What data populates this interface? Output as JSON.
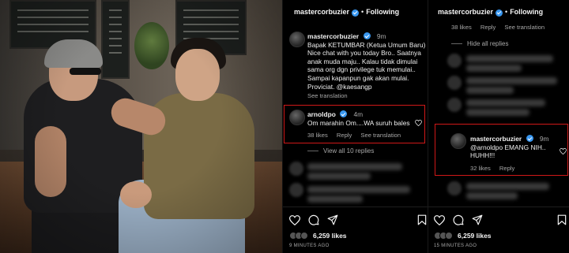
{
  "left_panel": {
    "header": {
      "username": "mastercorbuzier",
      "separator": "•",
      "follow_label": "Following"
    },
    "caption": {
      "username": "mastercorbuzier",
      "time": "9m",
      "lines": [
        "Bapak KETUMBAR (Ketua Umum Baru)",
        "Nice chat with you today Bro.. Saatnya",
        "anak muda maju.. Kalau tidak dimulai",
        "sama org dgn privilege tuk memulai..",
        "Sampai kapanpun gak akan mulai.",
        "Proviciat. @kaesangp"
      ],
      "see_translation": "See translation"
    },
    "highlighted_comment": {
      "username": "arnoldpo",
      "time": "4m",
      "text": "Om marahin Om....WA suruh bales",
      "likes": "38 likes",
      "reply": "Reply",
      "see_translation": "See translation"
    },
    "view_replies": "View all 10 replies",
    "likes_count": "6,259 likes",
    "time_ago": "9 MINUTES AGO"
  },
  "right_panel": {
    "header": {
      "username": "mastercorbuzier",
      "separator": "•",
      "follow_label": "Following"
    },
    "top_meta": {
      "likes": "38 likes",
      "reply": "Reply",
      "see_translation": "See translation"
    },
    "hide_replies": "Hide all replies",
    "highlighted_comment": {
      "username": "mastercorbuzier",
      "time": "9m",
      "line1": "@arnoldpo EMANG NIH..",
      "line2": "HUHH!!!",
      "likes": "32 likes",
      "reply": "Reply"
    },
    "likes_count": "6,259 likes",
    "time_ago": "15 MINUTES AGO"
  },
  "colors": {
    "background": "#000000",
    "highlight_box": "#d01818",
    "verified_badge": "#3897f0",
    "secondary_text": "#a8a8a8"
  },
  "icons": [
    "verified-badge-icon",
    "heart-icon",
    "comment-icon",
    "share-icon",
    "bookmark-icon"
  ]
}
